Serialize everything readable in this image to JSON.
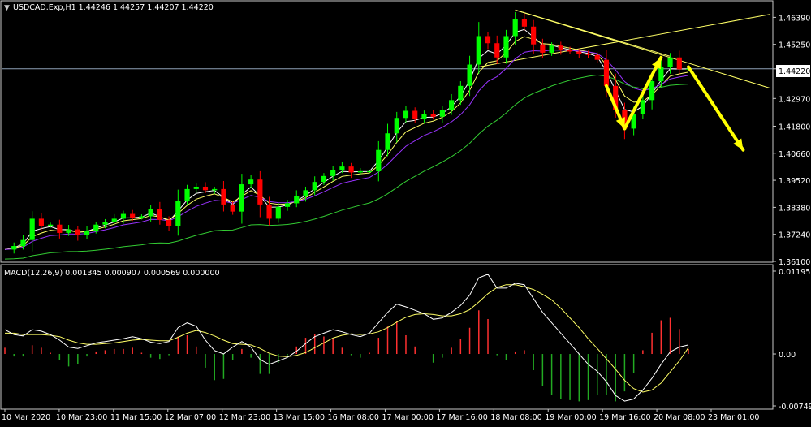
{
  "window": {
    "symbol_header": "USDCAD.Exp,H1  1.44246 1.44257 1.44207 1.44220",
    "dropdown_glyph": "▼",
    "current_price_label": "1.44220"
  },
  "colors": {
    "background": "#000000",
    "axis": "#c8c8c8",
    "text": "#ffffff",
    "bull_candle": "#00ff00",
    "bear_candle": "#ff0000",
    "bid_line": "#8ea0b6",
    "ma_fast": "#ffffff",
    "ma_mid": "#ffff66",
    "ma_slow": "#9933ff",
    "ma_trend": "#33cc33",
    "trendline": "#ffff66",
    "arrow": "#ffff00",
    "macd_line": "#ffffff",
    "signal_line": "#ffff66",
    "hist_pos": "#ff3030",
    "hist_neg": "#22aa22"
  },
  "chart_data": [
    {
      "type": "candlestick",
      "title": "USDCAD.Exp,H1  1.44246 1.44257 1.44207 1.44220",
      "timeframe": "H1",
      "last_ohlc": {
        "open": 1.44246,
        "high": 1.44257,
        "low": 1.44207,
        "close": 1.4422
      },
      "ylim": [
        1.361,
        1.4678
      ],
      "y_ticks": [
        "1.46390",
        "1.45250",
        "1.44220",
        "1.42970",
        "1.41800",
        "1.40660",
        "1.39520",
        "1.38380",
        "1.37240",
        "1.36100"
      ],
      "x_ticks": [
        "10 Mar 2020",
        "10 Mar 23:00",
        "11 Mar 15:00",
        "12 Mar 07:00",
        "12 Mar 23:00",
        "13 Mar 15:00",
        "16 Mar 08:00",
        "17 Mar 00:00",
        "17 Mar 16:00",
        "18 Mar 08:00",
        "19 Mar 00:00",
        "19 Mar 16:00",
        "20 Mar 08:00",
        "23 Mar 01:00"
      ],
      "closes": [
        1.366,
        1.3675,
        1.37,
        1.379,
        1.376,
        1.3765,
        1.373,
        1.3745,
        1.372,
        1.374,
        1.3765,
        1.3775,
        1.379,
        1.381,
        1.3795,
        1.38,
        1.383,
        1.3785,
        1.376,
        1.3865,
        1.3915,
        1.3925,
        1.391,
        1.3915,
        1.385,
        1.382,
        1.3935,
        1.3955,
        1.385,
        1.379,
        1.384,
        1.3855,
        1.3885,
        1.391,
        1.3945,
        1.397,
        1.3995,
        1.401,
        1.3985,
        1.399,
        1.399,
        1.408,
        1.415,
        1.4215,
        1.4245,
        1.421,
        1.423,
        1.422,
        1.425,
        1.429,
        1.435,
        1.444,
        1.456,
        1.453,
        1.447,
        1.456,
        1.463,
        1.46,
        1.4525,
        1.449,
        1.452,
        1.45,
        1.4495,
        1.4485,
        1.448,
        1.446,
        1.435,
        1.425,
        1.417,
        1.423,
        1.429,
        1.437,
        1.443,
        1.447,
        1.442,
        1.4422
      ],
      "moving_averages": [
        "white",
        "yellow",
        "purple",
        "green"
      ]
    },
    {
      "type": "line",
      "title": "MACD(12,26,9) 0.001345 0.000907 0.000569 0.000000",
      "ylim": [
        -0.007494,
        0.011951
      ],
      "y_ticks": [
        "0.011951",
        "0.00",
        "-0.007494"
      ],
      "series": [
        {
          "values": [
            0.0035,
            0.0028,
            0.0026,
            0.0035,
            0.0033,
            0.0028,
            0.002,
            0.001,
            0.0008,
            0.0012,
            0.0016,
            0.0018,
            0.002,
            0.0022,
            0.0025,
            0.0022,
            0.0017,
            0.0015,
            0.0018,
            0.0038,
            0.0045,
            0.004,
            0.002,
            0.0005,
            0.0,
            0.001,
            0.0018,
            0.001,
            -0.0008,
            -0.0015,
            -0.001,
            -0.0005,
            0.0004,
            0.0015,
            0.0025,
            0.003,
            0.0035,
            0.0032,
            0.0028,
            0.0025,
            0.003,
            0.0045,
            0.006,
            0.0072,
            0.0068,
            0.0063,
            0.0058,
            0.005,
            0.0052,
            0.006,
            0.007,
            0.0085,
            0.011,
            0.0115,
            0.0095,
            0.0095,
            0.0102,
            0.01,
            0.008,
            0.006,
            0.0045,
            0.003,
            0.0015,
            0.0,
            -0.0015,
            -0.0025,
            -0.004,
            -0.006,
            -0.0068,
            -0.0065,
            -0.0052,
            -0.0035,
            -0.0015,
            0.0003,
            0.001,
            0.0013
          ]
        },
        {
          "values": [
            0.003,
            0.003,
            0.0028,
            0.0028,
            0.0028,
            0.0027,
            0.0025,
            0.002,
            0.0016,
            0.0014,
            0.0014,
            0.0015,
            0.0016,
            0.0018,
            0.002,
            0.0021,
            0.002,
            0.0019,
            0.0019,
            0.0024,
            0.003,
            0.0034,
            0.0031,
            0.0026,
            0.002,
            0.0015,
            0.0014,
            0.0013,
            0.0008,
            0.0001,
            -0.0003,
            -0.0004,
            -0.0002,
            0.0002,
            0.0009,
            0.0016,
            0.0023,
            0.0027,
            0.0029,
            0.0028,
            0.0029,
            0.0032,
            0.0038,
            0.0046,
            0.0053,
            0.0057,
            0.0058,
            0.0057,
            0.0055,
            0.0055,
            0.0058,
            0.0064,
            0.0075,
            0.0087,
            0.0096,
            0.01,
            0.01,
            0.0097,
            0.0093,
            0.0086,
            0.0078,
            0.0066,
            0.0052,
            0.0038,
            0.0022,
            0.0008,
            -0.0007,
            -0.0022,
            -0.0038,
            -0.005,
            -0.0055,
            -0.0052,
            -0.0042,
            -0.0026,
            -0.001,
            0.0009
          ]
        }
      ],
      "histogram": "macd_minus_signal"
    }
  ]
}
